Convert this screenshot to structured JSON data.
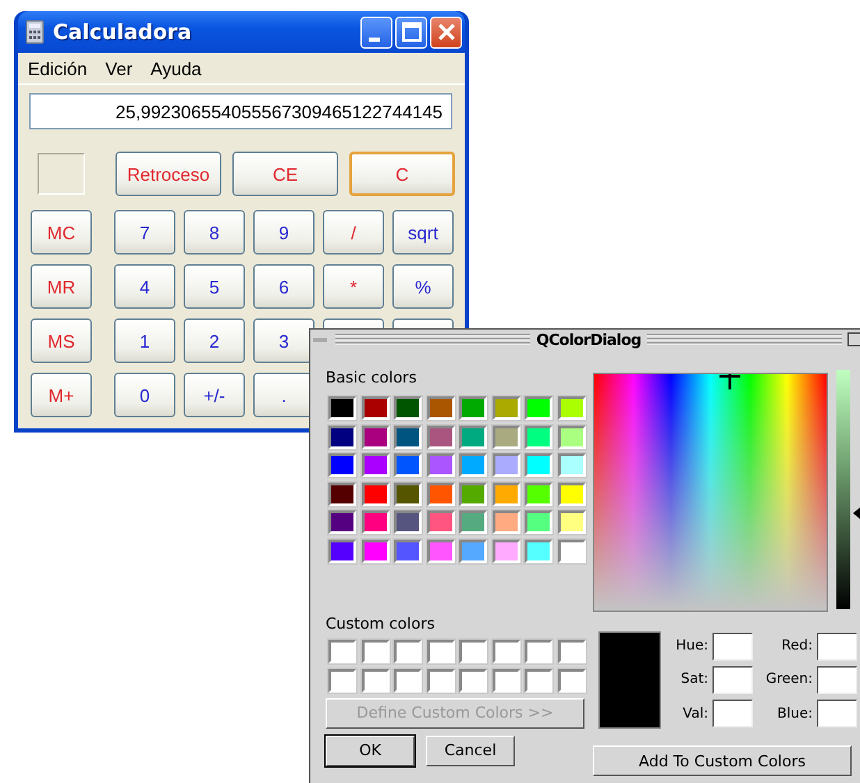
{
  "calculator": {
    "title": "Calculadora",
    "menu": [
      {
        "label": "Edición"
      },
      {
        "label": "Ver"
      },
      {
        "label": "Ayuda"
      }
    ],
    "display": {
      "value": "25,992306554055567309465122744145"
    },
    "memory_indicator": {
      "on": false
    },
    "top_keys": [
      {
        "label": "Retroceso",
        "kind": "control",
        "focused": false
      },
      {
        "label": "CE",
        "kind": "control",
        "focused": false
      },
      {
        "label": "C",
        "kind": "control",
        "focused": true
      }
    ],
    "key_rows": [
      [
        {
          "label": "MC",
          "kind": "memory"
        },
        {
          "label": "7",
          "kind": "digit"
        },
        {
          "label": "8",
          "kind": "digit"
        },
        {
          "label": "9",
          "kind": "digit"
        },
        {
          "label": "/",
          "kind": "operator"
        },
        {
          "label": "sqrt",
          "kind": "function"
        }
      ],
      [
        {
          "label": "MR",
          "kind": "memory"
        },
        {
          "label": "4",
          "kind": "digit"
        },
        {
          "label": "5",
          "kind": "digit"
        },
        {
          "label": "6",
          "kind": "digit"
        },
        {
          "label": "*",
          "kind": "operator"
        },
        {
          "label": "%",
          "kind": "function"
        }
      ],
      [
        {
          "label": "MS",
          "kind": "memory"
        },
        {
          "label": "1",
          "kind": "digit"
        },
        {
          "label": "2",
          "kind": "digit"
        },
        {
          "label": "3",
          "kind": "digit"
        },
        {
          "kind": "covered"
        },
        {
          "kind": "covered"
        }
      ],
      [
        {
          "label": "M+",
          "kind": "memory"
        },
        {
          "label": "0",
          "kind": "digit"
        },
        {
          "label": "+/-",
          "kind": "function"
        },
        {
          "label": ".",
          "kind": "function"
        }
      ]
    ]
  },
  "color_dialog": {
    "title": "QColorDialog",
    "basic_colors_label": "Basic colors",
    "basic_colors": [
      {
        "color": "#000000"
      },
      {
        "color": "#aa0000"
      },
      {
        "color": "#005500"
      },
      {
        "color": "#aa5500"
      },
      {
        "color": "#00aa00"
      },
      {
        "color": "#aaaa00"
      },
      {
        "color": "#00ff00"
      },
      {
        "color": "#aaff00"
      },
      {
        "color": "#000080"
      },
      {
        "color": "#aa0080"
      },
      {
        "color": "#005580"
      },
      {
        "color": "#aa5580"
      },
      {
        "color": "#00aa80"
      },
      {
        "color": "#aaaa80"
      },
      {
        "color": "#00ff80"
      },
      {
        "color": "#aaff80"
      },
      {
        "color": "#0000ff"
      },
      {
        "color": "#aa00ff"
      },
      {
        "color": "#0055ff"
      },
      {
        "color": "#aa55ff"
      },
      {
        "color": "#00aaff"
      },
      {
        "color": "#aaaaff"
      },
      {
        "color": "#00ffff"
      },
      {
        "color": "#aaffff"
      },
      {
        "color": "#550000"
      },
      {
        "color": "#ff0000"
      },
      {
        "color": "#555500"
      },
      {
        "color": "#ff5500"
      },
      {
        "color": "#55aa00"
      },
      {
        "color": "#ffaa00"
      },
      {
        "color": "#55ff00"
      },
      {
        "color": "#ffff00"
      },
      {
        "color": "#550080"
      },
      {
        "color": "#ff0080"
      },
      {
        "color": "#555580"
      },
      {
        "color": "#ff5580"
      },
      {
        "color": "#55aa80"
      },
      {
        "color": "#ffaa80"
      },
      {
        "color": "#55ff80"
      },
      {
        "color": "#ffff80"
      },
      {
        "color": "#5500ff"
      },
      {
        "color": "#ff00ff"
      },
      {
        "color": "#5555ff"
      },
      {
        "color": "#ff55ff"
      },
      {
        "color": "#55aaff"
      },
      {
        "color": "#ffaaff"
      },
      {
        "color": "#55ffff"
      },
      {
        "color": "#ffffff"
      }
    ],
    "custom_colors_label": "Custom colors",
    "custom_colors": [
      {
        "color": "#ffffff"
      },
      {
        "color": "#ffffff"
      },
      {
        "color": "#ffffff"
      },
      {
        "color": "#ffffff"
      },
      {
        "color": "#ffffff"
      },
      {
        "color": "#ffffff"
      },
      {
        "color": "#ffffff"
      },
      {
        "color": "#ffffff"
      },
      {
        "color": "#ffffff"
      },
      {
        "color": "#ffffff"
      },
      {
        "color": "#ffffff"
      },
      {
        "color": "#ffffff"
      },
      {
        "color": "#ffffff"
      },
      {
        "color": "#ffffff"
      },
      {
        "color": "#ffffff"
      },
      {
        "color": "#ffffff"
      }
    ],
    "define_button": {
      "label": "Define Custom Colors >>",
      "disabled": true
    },
    "value_slider": {
      "level": 0.4
    },
    "preview": {
      "color": "#000000"
    },
    "fields": [
      {
        "label": "Hue:"
      },
      {
        "label": "Red:"
      },
      {
        "label": "Sat:"
      },
      {
        "label": "Green:"
      },
      {
        "label": "Val:"
      },
      {
        "label": "Blue:"
      }
    ],
    "buttons": [
      {
        "label": "OK",
        "default": true
      },
      {
        "label": "Cancel",
        "default": false
      }
    ],
    "add_button": {
      "label": "Add To Custom Colors"
    }
  }
}
